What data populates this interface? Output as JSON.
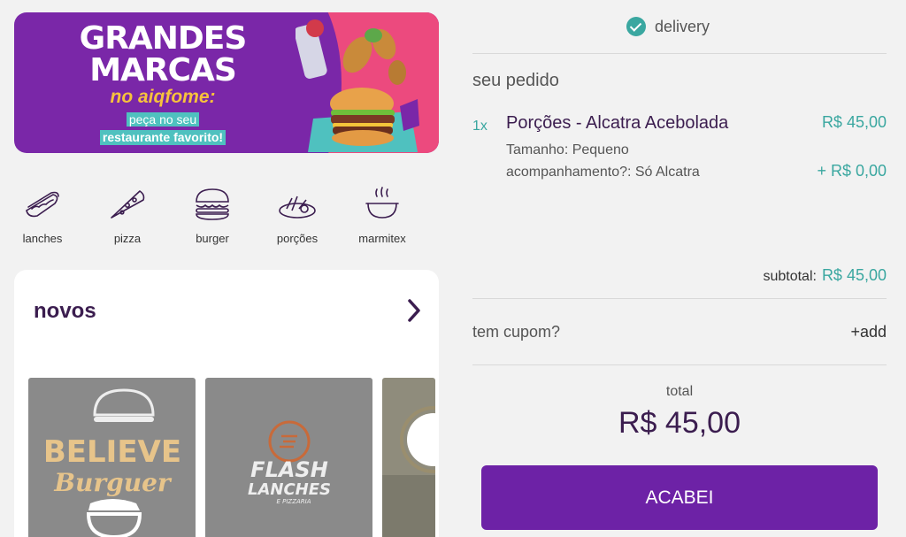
{
  "banner": {
    "line1": "GRANDES",
    "line2": "MARCAS",
    "line3": "no aiqfome:",
    "line4": "peça no seu",
    "line5": "restaurante favorito!"
  },
  "categories": [
    {
      "label": "lanches",
      "icon": "hotdog-icon"
    },
    {
      "label": "pizza",
      "icon": "pizza-icon"
    },
    {
      "label": "burger",
      "icon": "burger-icon"
    },
    {
      "label": "porções",
      "icon": "portions-icon"
    },
    {
      "label": "marmitex",
      "icon": "marmitex-icon"
    }
  ],
  "novos": {
    "title": "novos",
    "restaurants": [
      {
        "logo_line1": "BELIEVE",
        "logo_line2": "Burguer"
      },
      {
        "logo_line1": "FLASH",
        "logo_line2": "LANCHES",
        "logo_line3": "E PIZZARIA"
      }
    ]
  },
  "order": {
    "delivery_label": "delivery",
    "section_title": "seu pedido",
    "item": {
      "qty": "1x",
      "name": "Porções - Alcatra Acebolada",
      "price": "R$ 45,00",
      "option1": "Tamanho: Pequeno",
      "option2": "acompanhamento?: Só Alcatra",
      "option2_price": "+ R$ 0,00"
    },
    "subtotal_label": "subtotal:",
    "subtotal_value": "R$ 45,00",
    "coupon_label": "tem cupom?",
    "coupon_action": "+add",
    "total_label": "total",
    "total_value": "R$ 45,00",
    "finish_button": "ACABEI"
  },
  "colors": {
    "purple": "#6d22a6",
    "teal": "#3aa7a0",
    "pink": "#ec4a7e",
    "dark_text": "#3b1d4f"
  }
}
